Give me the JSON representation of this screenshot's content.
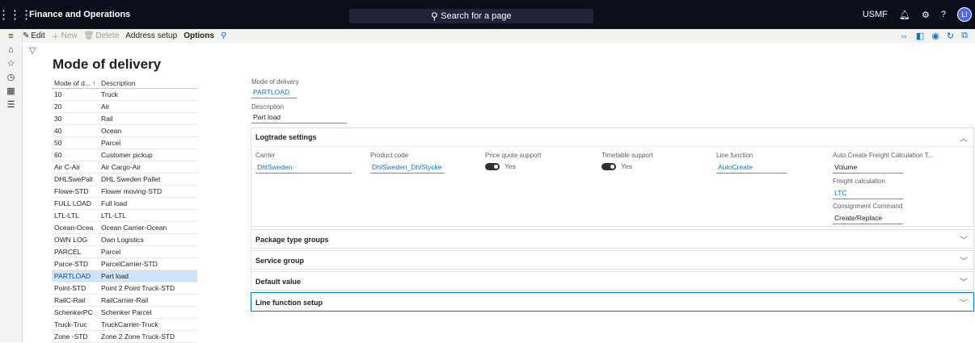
{
  "topbar": {
    "app_title": "Finance and Operations",
    "search_placeholder": "Search for a page",
    "company": "USMF",
    "help": "?",
    "avatar_initials": "LI"
  },
  "actions": {
    "edit": "Edit",
    "new": "New",
    "delete": "Delete",
    "address_setup": "Address setup",
    "options": "Options"
  },
  "page": {
    "title": "Mode of delivery"
  },
  "grid": {
    "headers": {
      "code": "Mode of d...",
      "sort": "↑",
      "description": "Description"
    },
    "rows": [
      {
        "code": "10",
        "desc": "Truck"
      },
      {
        "code": "20",
        "desc": "Air"
      },
      {
        "code": "30",
        "desc": "Rail"
      },
      {
        "code": "40",
        "desc": "Ocean"
      },
      {
        "code": "50",
        "desc": "Parcel"
      },
      {
        "code": "60",
        "desc": "Customer pickup"
      },
      {
        "code": "Air C-Air",
        "desc": "Air Cargo-Air"
      },
      {
        "code": "DHLSwePall",
        "desc": "DHL Sweden Pallet"
      },
      {
        "code": "Flowe-STD",
        "desc": "Flower moving-STD"
      },
      {
        "code": "FULL LOAD",
        "desc": "Full load"
      },
      {
        "code": "LTL-LTL",
        "desc": "LTL-LTL"
      },
      {
        "code": "Ocean-Ocea",
        "desc": "Ocean Carrier-Ocean"
      },
      {
        "code": "OWN LOG",
        "desc": "Own Logistics"
      },
      {
        "code": "PARCEL",
        "desc": "Parcel"
      },
      {
        "code": "Parce-STD",
        "desc": "ParcelCarrier-STD"
      },
      {
        "code": "PARTLOAD",
        "desc": "Part load"
      },
      {
        "code": "Point-STD",
        "desc": "Point 2 Point Truck-STD"
      },
      {
        "code": "RailC-Rail",
        "desc": "RailCarrier-Rail"
      },
      {
        "code": "SchenkerPC",
        "desc": "Schenker Parcel"
      },
      {
        "code": "Truck-Truc",
        "desc": "TruckCarrier-Truck"
      },
      {
        "code": "Zone -STD",
        "desc": "Zone 2 Zone Truck-STD"
      }
    ],
    "selected_index": 15
  },
  "detail": {
    "mode_label": "Mode of delivery",
    "mode_value": "PARTLOAD",
    "desc_label": "Description",
    "desc_value": "Part load"
  },
  "logtrade": {
    "title": "Logtrade settings",
    "carrier_label": "Carrier",
    "carrier_value": "DhlSweden",
    "product_label": "Product code",
    "product_value": "DhlSweden_DhlStycke",
    "price_label": "Price quote support",
    "price_value": "Yes",
    "timetable_label": "Timetable support",
    "timetable_value": "Yes",
    "linefunc_label": "Line function",
    "linefunc_value": "AutoCreate",
    "auto_label": "Auto Create Freight Calculation T...",
    "auto_value": "Volume",
    "freight_label": "Freight calculation",
    "freight_value": "LTC",
    "consign_label": "Consignment Command",
    "consign_value": "Create/Replace"
  },
  "tabs": {
    "package": "Package type groups",
    "service": "Service group",
    "default": "Default value",
    "linefunc": "Line function setup"
  }
}
